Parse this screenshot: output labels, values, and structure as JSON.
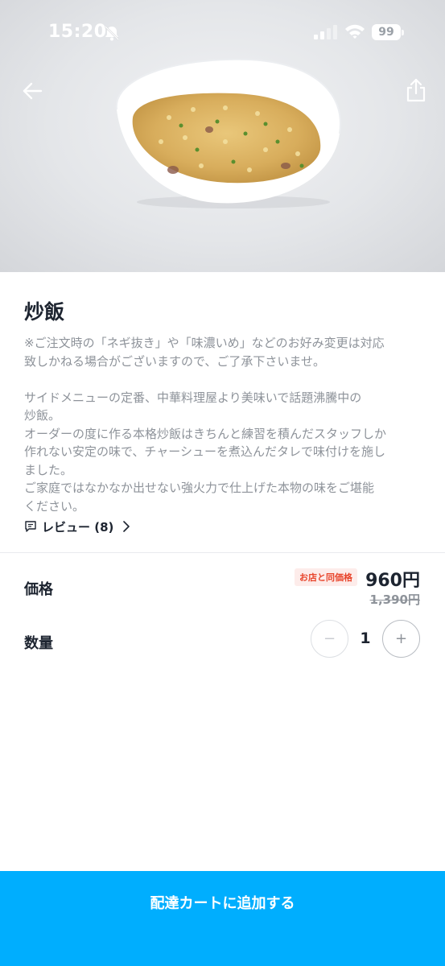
{
  "status_bar": {
    "time": "15:20",
    "battery": "99",
    "icons": [
      "bell-slash-icon",
      "signal-icon",
      "wifi-icon",
      "battery-icon"
    ]
  },
  "header": {
    "back_icon": "arrow-left-icon",
    "share_icon": "share-icon"
  },
  "product": {
    "title": "炒飯",
    "description": "※ご注文時の「ネギ抜き」や「味濃いめ」などのお好み変更は対応\n致しかねる場合がございますので、ご了承下さいませ。\n\nサイドメニューの定番、中華料理屋より美味いで話題沸騰中の\n炒飯。\nオーダーの度に作る本格炒飯はきちんと練習を積んだスタッフしか\n作れない安定の味で、チャーシューを煮込んだタレで味付けを施し\nました。\nご家庭ではなかなか出せない強火力で仕上げた本物の味をご堪能\nください。",
    "review_label": "レビュー (8)"
  },
  "price": {
    "label": "価格",
    "badge": "お店と同価格",
    "current": "960円",
    "original": "1,390円"
  },
  "quantity": {
    "label": "数量",
    "minus": "−",
    "value": "1",
    "plus": "+"
  },
  "cart": {
    "button_label": "配達カートに追加する"
  },
  "colors": {
    "accent": "#00aefe",
    "badge_text": "#e8452c",
    "badge_bg": "#fdecea",
    "muted_text": "#8e939a"
  }
}
